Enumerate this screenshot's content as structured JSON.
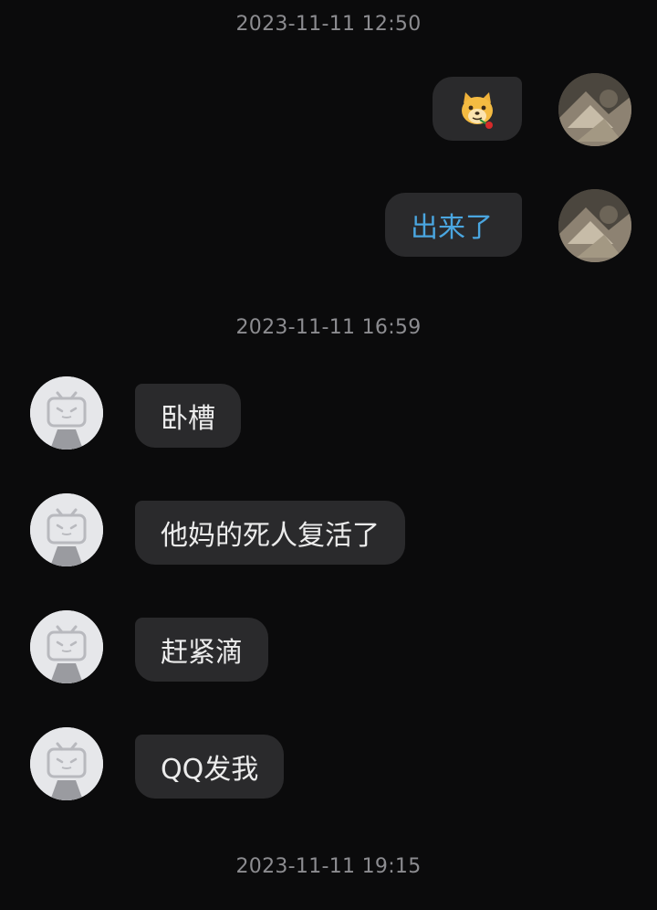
{
  "conversation": {
    "timestamps": [
      "2023-11-11 12:50",
      "2023-11-11 16:59",
      "2023-11-11 19:15"
    ],
    "outgoing": [
      {
        "type": "sticker",
        "icon": "dog-emoji-with-rose-icon"
      },
      {
        "type": "text",
        "text": "出来了"
      }
    ],
    "incoming": [
      {
        "text": "卧槽"
      },
      {
        "text": "他妈的死人复活了"
      },
      {
        "text": "赶紧滴"
      },
      {
        "text": "QQ发我"
      }
    ]
  },
  "colors": {
    "background": "#0b0b0c",
    "bubble": "#2a2a2c",
    "link_text": "#4aa6e0",
    "timestamp": "#8c8c90"
  }
}
